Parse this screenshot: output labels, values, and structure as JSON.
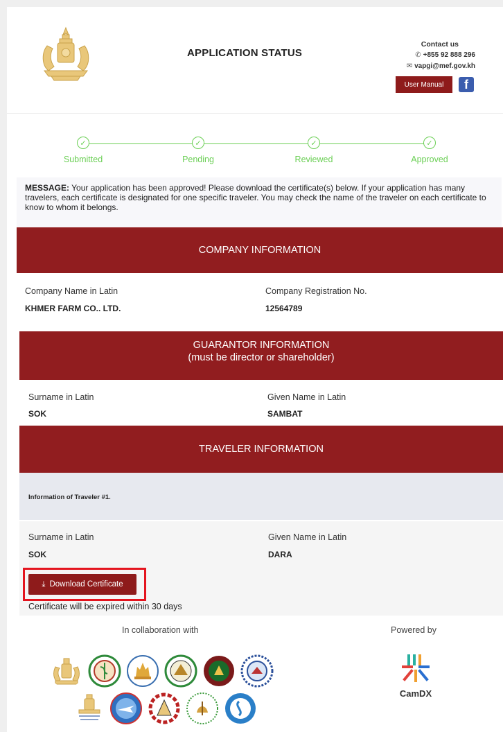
{
  "header": {
    "title": "APPLICATION STATUS",
    "contact_title": "Contact us",
    "phone": "+855 92 888 296",
    "email": "vapgi@mef.gov.kh",
    "user_manual_label": "User Manual",
    "facebook_glyph": "f"
  },
  "steps": [
    {
      "label": "Submitted",
      "done": true
    },
    {
      "label": "Pending",
      "done": true
    },
    {
      "label": "Reviewed",
      "done": true
    },
    {
      "label": "Approved",
      "done": true
    }
  ],
  "message": {
    "prefix": "MESSAGE:",
    "text": "Your application has been approved! Please download the certificate(s) below. If your application has many travelers, each certificate is designated for one specific traveler. You may check the name of the traveler on each certificate to know to whom it belongs."
  },
  "company": {
    "section_title": "COMPANY INFORMATION",
    "name_label": "Company Name in Latin",
    "name_value": "KHMER FARM CO.. LTD.",
    "reg_label": "Company Registration No.",
    "reg_value": "12564789"
  },
  "guarantor": {
    "section_title": "GUARANTOR INFORMATION",
    "section_subtitle": "(must be director or shareholder)",
    "surname_label": "Surname in Latin",
    "surname_value": "SOK",
    "given_label": "Given Name in Latin",
    "given_value": "SAMBAT"
  },
  "traveler": {
    "section_title": "TRAVELER INFORMATION",
    "sub_title": "Information of Traveler #1.",
    "surname_label": "Surname in Latin",
    "surname_value": "SOK",
    "given_label": "Given Name in Latin",
    "given_value": "DARA",
    "download_label": "Download Certificate",
    "expiry_note": "Certificate will be expired within 30 days"
  },
  "footer": {
    "collab_title": "In collaboration with",
    "powered_title": "Powered by",
    "powered_brand": "CamDX"
  },
  "colors": {
    "brand_red": "#911d1f",
    "step_green": "#6bcf55",
    "highlight_red": "#e4141e",
    "facebook_blue": "#3b5dae"
  }
}
